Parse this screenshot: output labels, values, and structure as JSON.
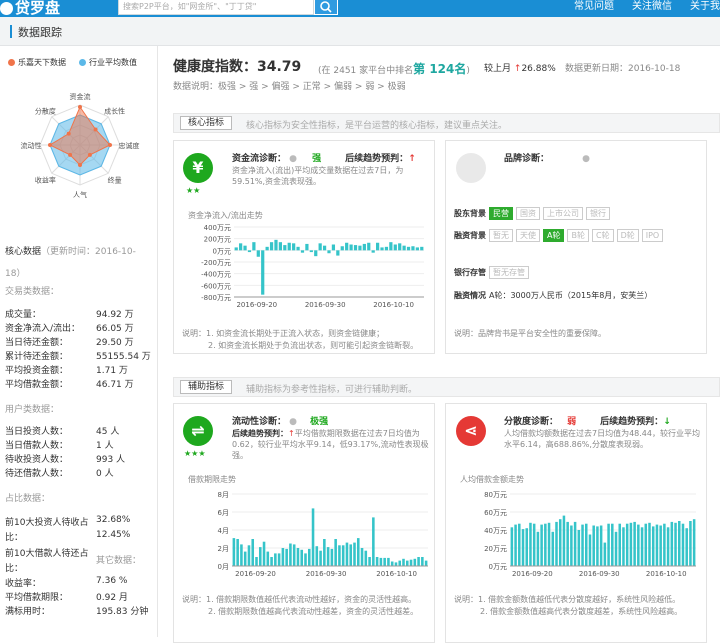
{
  "header": {
    "logo": "贷罗盘",
    "search_placeholder": "搜索P2P平台，如\"网金所\"、\"丁丁贷\"",
    "nav": [
      "常见问题",
      "关注微信",
      "关于我"
    ]
  },
  "section_title": "数据跟踪",
  "legend": [
    "乐嘉天下数据",
    "行业平均数值"
  ],
  "radar": {
    "axes": [
      "资金流",
      "成长性",
      "忠诚度",
      "终量",
      "人气",
      "收益率",
      "流动性",
      "分散度"
    ]
  },
  "core": {
    "title": "核心数据",
    "updated": "（更新时间：2016-10-18）",
    "updated_line1": "（更新时间：2016-10-",
    "updated_line2": "18）"
  },
  "trade": {
    "title": "交易类数据：",
    "rows": [
      {
        "k": "成交量：",
        "v": "94.92 万"
      },
      {
        "k": "资金净流入/流出：",
        "v": "66.05 万"
      },
      {
        "k": "当日待还金额：",
        "v": "29.50 万"
      },
      {
        "k": "累计待还金额：",
        "v": "55155.54 万"
      },
      {
        "k": "平均投资金额：",
        "v": "1.71 万"
      },
      {
        "k": "平均借款金额：",
        "v": "46.71 万"
      }
    ]
  },
  "users": {
    "title": "用户类数据：",
    "rows": [
      {
        "k": "当日投资人数：",
        "v": "45 人"
      },
      {
        "k": "当日借款人数：",
        "v": "1 人"
      },
      {
        "k": "待收投资人数：",
        "v": "993 人"
      },
      {
        "k": "待还借款人数：",
        "v": "0 人"
      }
    ]
  },
  "ratio": {
    "title": "占比数据：",
    "row1_k": "前10大投资人待收占",
    "row1_v": "32.68%",
    "row1_k2": "比：",
    "row2_v": "12.45%",
    "row3_k": "前10大借款人待还占",
    "row3_v": "其它数据：",
    "row3_k2": "比："
  },
  "other": {
    "rows": [
      {
        "k": "收益率：",
        "v": "7.36 %"
      },
      {
        "k": "平均借款期限：",
        "v": "0.92 月"
      },
      {
        "k": "满标用时：",
        "v": "195.83 分钟"
      }
    ]
  },
  "health": {
    "label": "健康度指数：",
    "value": "34.79",
    "rank_pre": "(在 2451 家平台中排名",
    "rank": "第 124名",
    "rank_post": ")",
    "vs_label": "较上月",
    "vs_arrow": "↑",
    "vs_value": "26.88%",
    "update": "数据更新日期：2016-10-18",
    "explain": "数据说明：极强 > 强 > 偏强 > 正常 > 偏弱 > 弱 > 极弱"
  },
  "core_tab": {
    "label": "核心指标",
    "desc": "核心指标为安全性指标，是平台运营的核心指标，建议重点关注。"
  },
  "aux_tab": {
    "label": "辅助指标",
    "desc": "辅助指标为参考性指标，可进行辅助判断。"
  },
  "card1": {
    "title": "资金流诊断：",
    "level": "强",
    "trend_label": "后续趋势预判：",
    "trend_arrow": "↑",
    "stars": "★★",
    "desc": "资金净流入(流出)平均成交量数据在过去7日，为59.51%,资金流表现强。",
    "chart_title": "资金净流入/流出走势",
    "note1": "说明：1. 如资金流长期处于正流入状态，则资金链健康；",
    "note2": "2. 如资金流长期处于负流出状态，则可能引起资金链断裂。"
  },
  "card2": {
    "title": "品牌诊断：",
    "bg_label": "股东背景",
    "bg_tags": [
      "民营",
      "国资",
      "上市公司",
      "银行"
    ],
    "fin_label": "融资背景",
    "fin_tags": [
      "天使",
      "A轮",
      "B轮",
      "C轮",
      "D轮",
      "IPO"
    ],
    "fin_pre": "暂无",
    "bank_label": "银行存管",
    "bank_value": "暂无存管",
    "info_label": "融资情况",
    "info_value": "A轮：3000万人民币（2015年8月，安芙兰）",
    "note": "说明：品牌背书是平台安全性的重要保障。"
  },
  "card3": {
    "title": "流动性诊断：",
    "level": "极强",
    "trend_label": "后续趋势预判：",
    "trend_arrow": "↑",
    "stars": "★★★",
    "desc": "平均借款期限数据在过去7日均值为0.62，较行业平均水平9.14，低93.17%,流动性表现极强。",
    "chart_title": "借款期限走势",
    "note1": "说明：1. 借款期限数值越低代表流动性越好，资金的灵活性越高。",
    "note2": "2. 借款期限数值越高代表流动性越差，资金的灵活性越差。"
  },
  "card4": {
    "title": "分散度诊断：",
    "level": "弱",
    "trend_label": "后续趋势预判：",
    "trend_arrow": "↓",
    "desc": "人均借款均额数据在过去7日均值为48.44，较行业平均水平6.14，高688.86%,分散度表现弱。",
    "chart_title": "人均借款金额走势",
    "note1": "说明：1. 借款金额数值越低代表分散度越好，系统性风险越低。",
    "note2": "2. 借款金额数值越高代表分散度越差，系统性风险越高。"
  },
  "colors": {
    "brand": "#1a8ed4",
    "up": "#e53935",
    "green": "#1ea81e",
    "bar": "#35c4c9",
    "orange": "#f0744a",
    "blue": "#5bb8e8"
  },
  "chart_data": [
    {
      "type": "bar",
      "title": "资金净流入/流出走势",
      "categories": [
        "2016-09-20",
        "2016-09-30",
        "2016-10-10"
      ],
      "yticks": [
        "400万元",
        "200万元",
        "0万元",
        "-200万元",
        "-400万元",
        "-600万元",
        "-800万元"
      ],
      "ylim": [
        -800,
        400
      ],
      "values": [
        50,
        120,
        80,
        -30,
        140,
        -110,
        -760,
        60,
        140,
        180,
        140,
        90,
        130,
        120,
        60,
        -40,
        110,
        -30,
        -100,
        120,
        80,
        -50,
        100,
        -90,
        70,
        130,
        100,
        90,
        80,
        110,
        130,
        -40,
        130,
        50,
        60,
        140,
        100,
        120,
        80,
        60,
        70,
        50,
        60
      ]
    },
    {
      "type": "bar",
      "title": "借款期限走势",
      "categories": [
        "2016-09-20",
        "2016-09-30",
        "2016-10-10"
      ],
      "yticks": [
        "8月",
        "6月",
        "4月",
        "2月",
        "0月"
      ],
      "ylim": [
        0,
        8
      ],
      "values": [
        3.1,
        3.0,
        2.4,
        1.6,
        2.3,
        3.0,
        1.0,
        2.1,
        2.7,
        1.6,
        1.0,
        1.4,
        1.4,
        2.0,
        1.9,
        2.5,
        2.4,
        2.0,
        1.8,
        1.4,
        1.9,
        6.4,
        2.2,
        1.7,
        3.0,
        2.1,
        1.9,
        3.0,
        2.3,
        2.3,
        2.6,
        2.4,
        2.6,
        3.1,
        2.0,
        1.7,
        1.0,
        5.4,
        1.0,
        0.9,
        0.9,
        0.9,
        0.5,
        0.4,
        0.6,
        0.8,
        0.6,
        0.7,
        0.8,
        1.0,
        1.0,
        0.6
      ]
    },
    {
      "type": "bar",
      "title": "人均借款金额走势",
      "categories": [
        "2016-09-20",
        "2016-09-30",
        "2016-10-10"
      ],
      "yticks": [
        "80万元",
        "60万元",
        "40万元",
        "20万元",
        "0万元"
      ],
      "ylim": [
        0,
        80
      ],
      "values": [
        43,
        46,
        47,
        41,
        42,
        48,
        47,
        38,
        46,
        47,
        48,
        38,
        49,
        52,
        56,
        49,
        45,
        49,
        40,
        46,
        47,
        35,
        45,
        44,
        45,
        26,
        47,
        47,
        38,
        47,
        43,
        47,
        48,
        49,
        46,
        43,
        47,
        48,
        44,
        46,
        45,
        47,
        43,
        49,
        48,
        50,
        47,
        42,
        50,
        52
      ]
    }
  ]
}
